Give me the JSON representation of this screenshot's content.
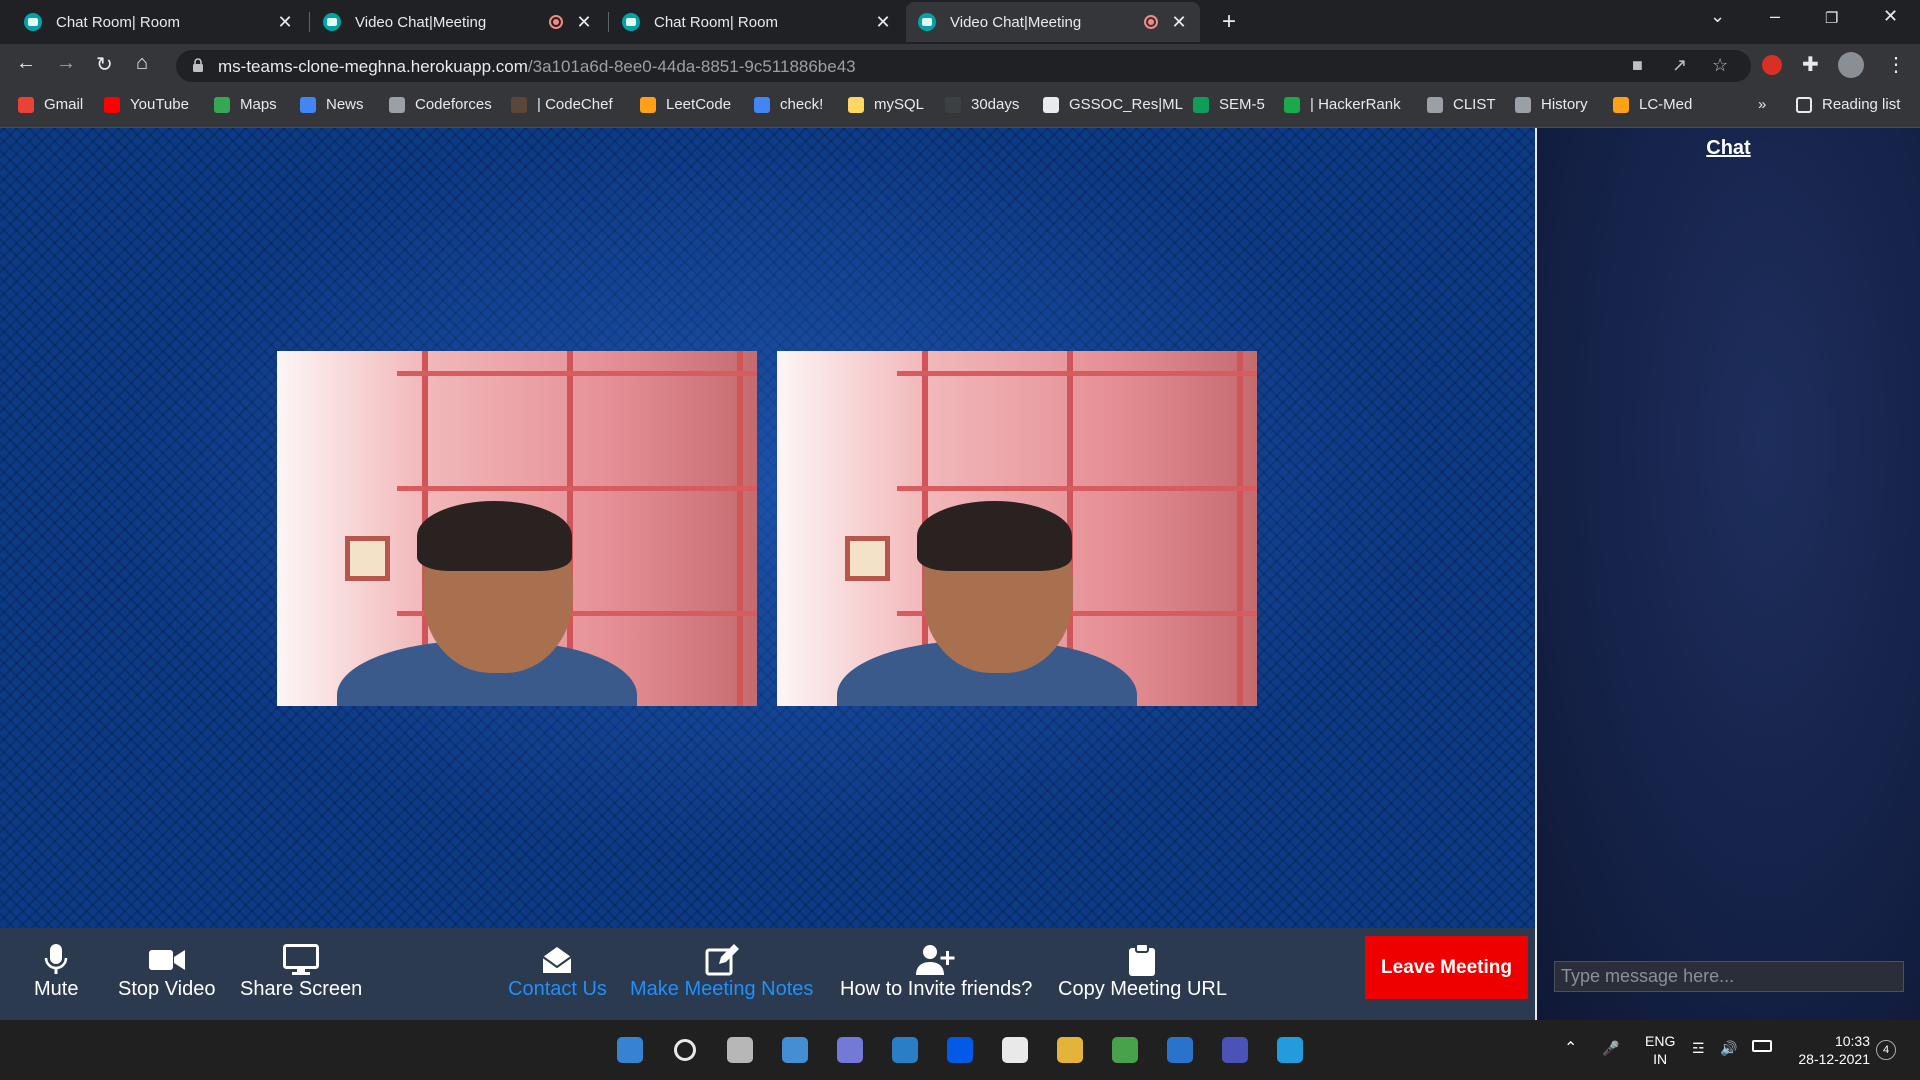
{
  "tabs": [
    {
      "title": "Chat Room| Room",
      "recording": false,
      "active": false
    },
    {
      "title": "Video Chat|Meeting",
      "recording": true,
      "active": false
    },
    {
      "title": "Chat Room| Room",
      "recording": false,
      "active": false
    },
    {
      "title": "Video Chat|Meeting",
      "recording": true,
      "active": true
    }
  ],
  "new_tab": "+",
  "window_controls": {
    "minimize": "–",
    "maximize": "❐",
    "close": "✕",
    "tab_search": "⌄"
  },
  "address": {
    "host": "ms-teams-clone-meghna.herokuapp.com",
    "path": "/3a101a6d-8ee0-44da-8851-9c511886be43"
  },
  "bookmarks": [
    {
      "label": "Gmail",
      "icon": "gmail-icon",
      "color": "#ea4335"
    },
    {
      "label": "YouTube",
      "icon": "youtube-icon",
      "color": "#ff0000"
    },
    {
      "label": "Maps",
      "icon": "maps-icon",
      "color": "#34a853"
    },
    {
      "label": "News",
      "icon": "news-icon",
      "color": "#4285f4"
    },
    {
      "label": "Codeforces",
      "icon": "globe-icon",
      "color": "#9aa0a6"
    },
    {
      "label": "| CodeChef",
      "icon": "codechef-icon",
      "color": "#5b4638"
    },
    {
      "label": "LeetCode",
      "icon": "leetcode-icon",
      "color": "#ffa116"
    },
    {
      "label": "check!",
      "icon": "docs-icon",
      "color": "#4285f4"
    },
    {
      "label": "mySQL",
      "icon": "folder-icon",
      "color": "#fdd663"
    },
    {
      "label": "30days",
      "icon": "30days-icon",
      "color": "#3c4043"
    },
    {
      "label": "GSSOC_Res|ML",
      "icon": "github-icon",
      "color": "#e8eaed"
    },
    {
      "label": "SEM-5",
      "icon": "sheets-plus-icon",
      "color": "#0f9d58"
    },
    {
      "label": "| HackerRank",
      "icon": "hackerrank-icon",
      "color": "#1ba94c"
    },
    {
      "label": "CLIST",
      "icon": "globe-icon",
      "color": "#9aa0a6"
    },
    {
      "label": "History",
      "icon": "history-icon",
      "color": "#9aa0a6"
    },
    {
      "label": "LC-Med",
      "icon": "leetcode-icon",
      "color": "#ffa116"
    }
  ],
  "bookmarks_more": "»",
  "reading_list": "Reading list",
  "controls": [
    {
      "label": "Mute",
      "icon": "microphone-icon",
      "color": "#ffffff"
    },
    {
      "label": "Stop Video",
      "icon": "video-camera-icon",
      "color": "#ffffff"
    },
    {
      "label": "Share Screen",
      "icon": "monitor-icon",
      "color": "#ffffff"
    },
    {
      "label": "Contact Us",
      "icon": "envelope-open-icon",
      "color": "#1e90ff"
    },
    {
      "label": "Make Meeting Notes",
      "icon": "edit-icon",
      "color": "#1e90ff"
    },
    {
      "label": "How to Invite friends?",
      "icon": "user-plus-icon",
      "color": "#ffffff"
    },
    {
      "label": "Copy Meeting URL",
      "icon": "clipboard-icon",
      "color": "#ffffff"
    }
  ],
  "leave_meeting": "Leave Meeting",
  "chat": {
    "title": "Chat",
    "placeholder": "Type message here..."
  },
  "taskbar": {
    "apps": [
      "windows-start-icon",
      "search-icon",
      "task-view-icon",
      "widgets-icon",
      "teams-chat-icon",
      "store-icon",
      "dropbox-icon",
      "power-automate-icon",
      "file-explorer-icon",
      "chrome-icon",
      "mail-icon",
      "teams-icon",
      "vscode-icon"
    ],
    "lang_top": "ENG",
    "lang_bottom": "IN",
    "time": "10:33",
    "date": "28-12-2021",
    "notifications": "4"
  }
}
